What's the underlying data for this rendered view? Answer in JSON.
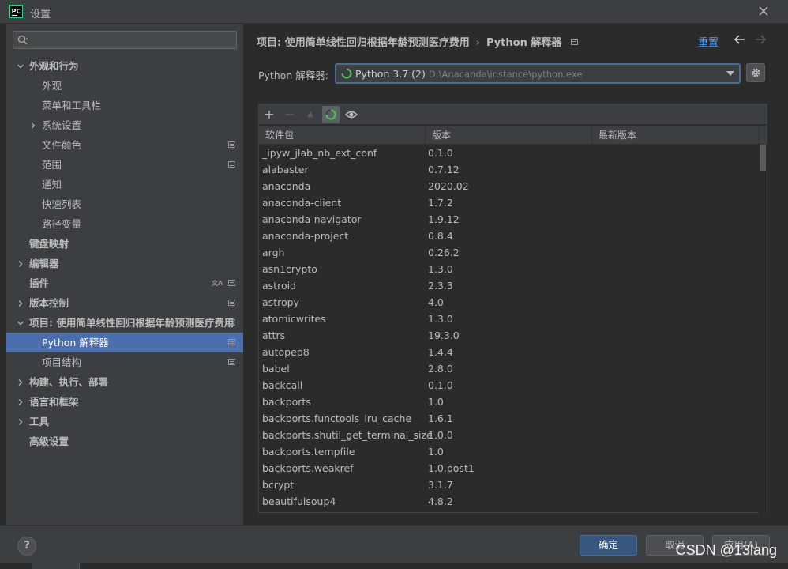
{
  "window": {
    "title": "设置",
    "app_icon_label": "PC",
    "close_icon": "close-icon"
  },
  "sidebar": {
    "search_placeholder": "",
    "items": [
      {
        "label": "外观和行为",
        "level": 0,
        "arrow": "down",
        "bold": true,
        "selected": false,
        "icon": ""
      },
      {
        "label": "外观",
        "level": 1,
        "arrow": "",
        "bold": false,
        "selected": false,
        "icon": ""
      },
      {
        "label": "菜单和工具栏",
        "level": 1,
        "arrow": "",
        "bold": false,
        "selected": false,
        "icon": ""
      },
      {
        "label": "系统设置",
        "level": 1,
        "arrow": "right",
        "bold": false,
        "selected": false,
        "icon": ""
      },
      {
        "label": "文件颜色",
        "level": 1,
        "arrow": "",
        "bold": false,
        "selected": false,
        "icon": "project"
      },
      {
        "label": "范围",
        "level": 1,
        "arrow": "",
        "bold": false,
        "selected": false,
        "icon": "project"
      },
      {
        "label": "通知",
        "level": 1,
        "arrow": "",
        "bold": false,
        "selected": false,
        "icon": ""
      },
      {
        "label": "快速列表",
        "level": 1,
        "arrow": "",
        "bold": false,
        "selected": false,
        "icon": ""
      },
      {
        "label": "路径变量",
        "level": 1,
        "arrow": "",
        "bold": false,
        "selected": false,
        "icon": ""
      },
      {
        "label": "键盘映射",
        "level": 0,
        "arrow": "",
        "bold": true,
        "selected": false,
        "icon": ""
      },
      {
        "label": "编辑器",
        "level": 0,
        "arrow": "right",
        "bold": true,
        "selected": false,
        "icon": ""
      },
      {
        "label": "插件",
        "level": 0,
        "arrow": "",
        "bold": true,
        "selected": false,
        "icon": "lang+project"
      },
      {
        "label": "版本控制",
        "level": 0,
        "arrow": "right",
        "bold": true,
        "selected": false,
        "icon": "project"
      },
      {
        "label": "项目: 使用简单线性回归根据年龄预测医疗费用",
        "level": 0,
        "arrow": "down",
        "bold": true,
        "selected": false,
        "icon": "project"
      },
      {
        "label": "Python 解释器",
        "level": 1,
        "arrow": "",
        "bold": false,
        "selected": true,
        "icon": "project"
      },
      {
        "label": "项目结构",
        "level": 1,
        "arrow": "",
        "bold": false,
        "selected": false,
        "icon": "project"
      },
      {
        "label": "构建、执行、部署",
        "level": 0,
        "arrow": "right",
        "bold": true,
        "selected": false,
        "icon": ""
      },
      {
        "label": "语言和框架",
        "level": 0,
        "arrow": "right",
        "bold": true,
        "selected": false,
        "icon": ""
      },
      {
        "label": "工具",
        "level": 0,
        "arrow": "right",
        "bold": true,
        "selected": false,
        "icon": ""
      },
      {
        "label": "高级设置",
        "level": 0,
        "arrow": "",
        "bold": true,
        "selected": false,
        "icon": ""
      }
    ]
  },
  "header": {
    "breadcrumb_project": "项目: 使用简单线性回归根据年龄预测医疗费用",
    "breadcrumb_separator": "›",
    "breadcrumb_page": "Python 解释器",
    "reset_label": "重置"
  },
  "interpreter": {
    "label": "Python 解释器:",
    "selected_name": "Python 3.7 (2)",
    "selected_path": "D:\\Anacanda\\instance\\python.exe"
  },
  "packages": {
    "toolbar": {
      "add": "+",
      "remove": "−",
      "upgrade": "▲"
    },
    "columns": [
      "软件包",
      "版本",
      "最新版本"
    ],
    "rows": [
      {
        "name": "_ipyw_jlab_nb_ext_conf",
        "version": "0.1.0",
        "latest": ""
      },
      {
        "name": "alabaster",
        "version": "0.7.12",
        "latest": ""
      },
      {
        "name": "anaconda",
        "version": "2020.02",
        "latest": ""
      },
      {
        "name": "anaconda-client",
        "version": "1.7.2",
        "latest": ""
      },
      {
        "name": "anaconda-navigator",
        "version": "1.9.12",
        "latest": ""
      },
      {
        "name": "anaconda-project",
        "version": "0.8.4",
        "latest": ""
      },
      {
        "name": "argh",
        "version": "0.26.2",
        "latest": ""
      },
      {
        "name": "asn1crypto",
        "version": "1.3.0",
        "latest": ""
      },
      {
        "name": "astroid",
        "version": "2.3.3",
        "latest": ""
      },
      {
        "name": "astropy",
        "version": "4.0",
        "latest": ""
      },
      {
        "name": "atomicwrites",
        "version": "1.3.0",
        "latest": ""
      },
      {
        "name": "attrs",
        "version": "19.3.0",
        "latest": ""
      },
      {
        "name": "autopep8",
        "version": "1.4.4",
        "latest": ""
      },
      {
        "name": "babel",
        "version": "2.8.0",
        "latest": ""
      },
      {
        "name": "backcall",
        "version": "0.1.0",
        "latest": ""
      },
      {
        "name": "backports",
        "version": "1.0",
        "latest": ""
      },
      {
        "name": "backports.functools_lru_cache",
        "version": "1.6.1",
        "latest": ""
      },
      {
        "name": "backports.shutil_get_terminal_size",
        "version": "1.0.0",
        "latest": ""
      },
      {
        "name": "backports.tempfile",
        "version": "1.0",
        "latest": ""
      },
      {
        "name": "backports.weakref",
        "version": "1.0.post1",
        "latest": ""
      },
      {
        "name": "bcrypt",
        "version": "3.1.7",
        "latest": ""
      },
      {
        "name": "beautifulsoup4",
        "version": "4.8.2",
        "latest": ""
      },
      {
        "name": "",
        "version": "",
        "latest": ""
      }
    ]
  },
  "footer": {
    "help_label": "?",
    "ok_label": "确定",
    "cancel_label": "取消",
    "apply_label": "应用(A)",
    "watermark": "CSDN @13lang"
  },
  "colors": {
    "selection": "#4b6eaf",
    "link": "#589df6",
    "ok_button": "#365880",
    "background": "#2b2b2b",
    "panel": "#3c3f41"
  }
}
